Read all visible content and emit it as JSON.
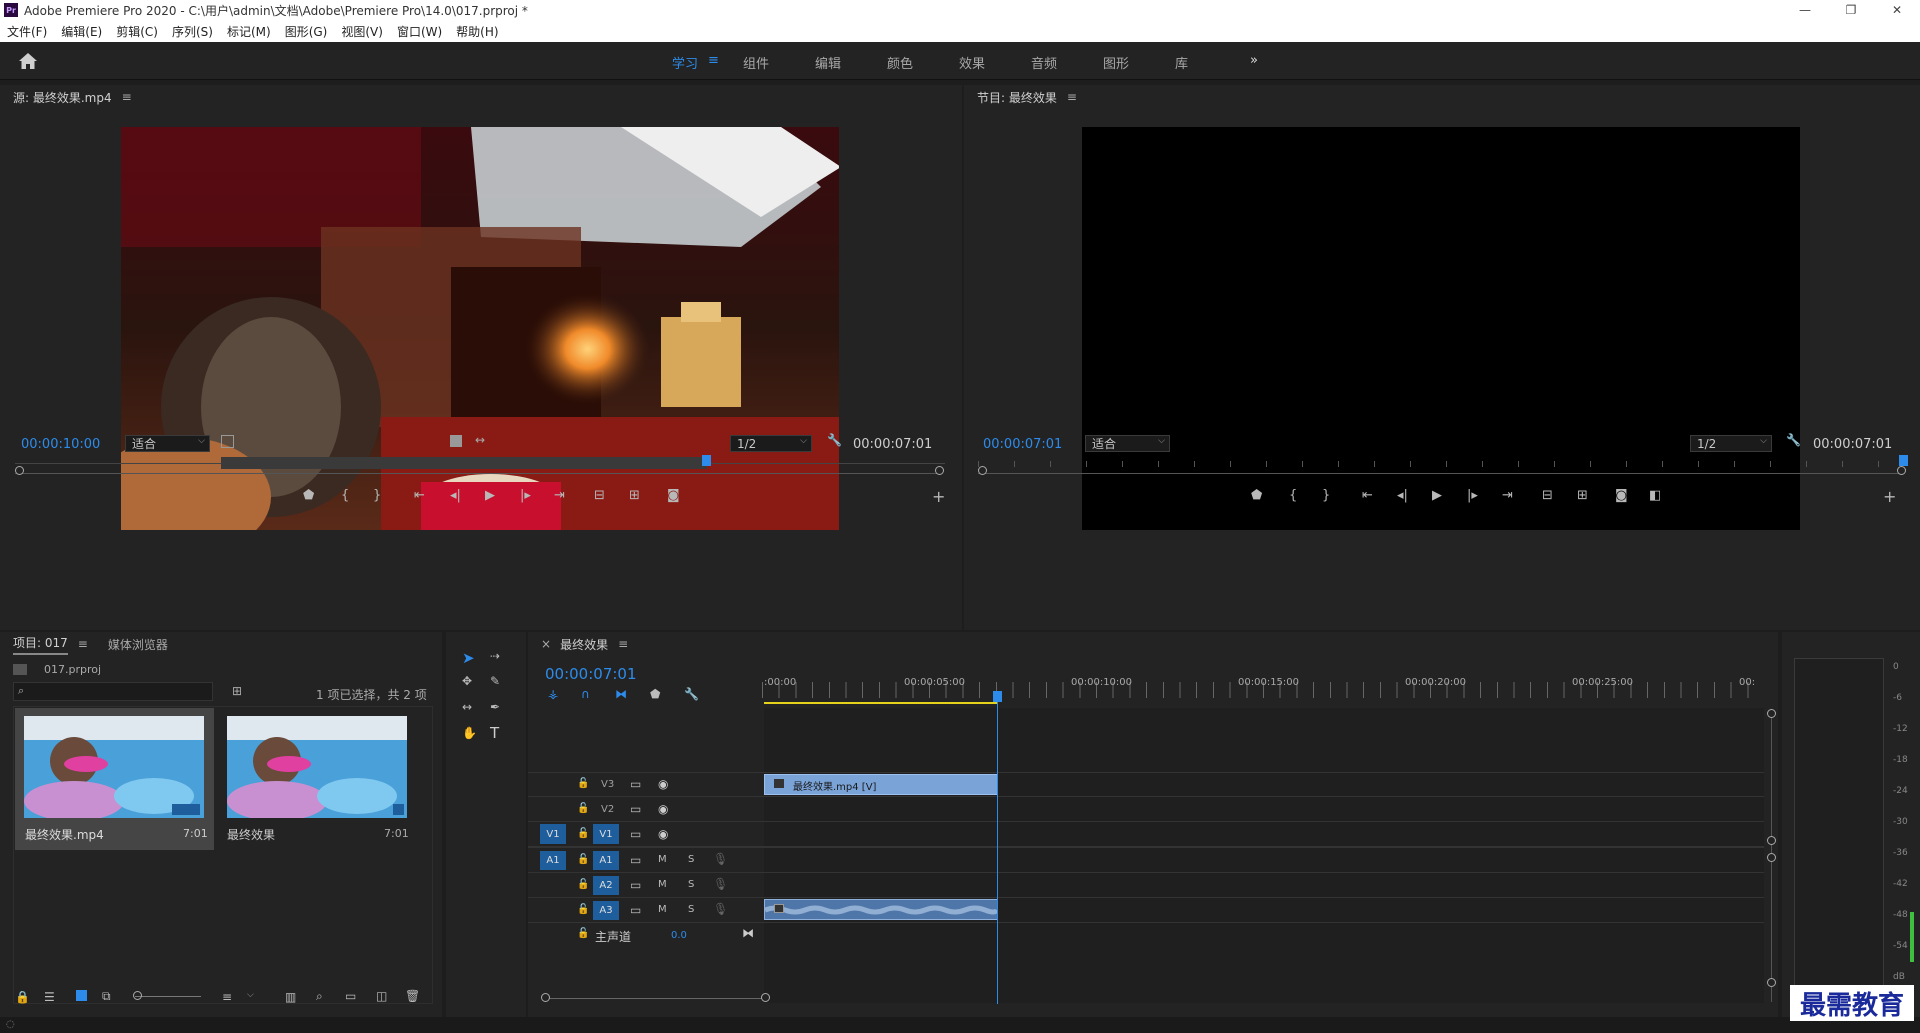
{
  "titlebar": {
    "icon": "Pr",
    "title": "Adobe Premiere Pro 2020 - C:\\用户\\admin\\文档\\Adobe\\Premiere Pro\\14.0\\017.prproj *",
    "minimize": "—",
    "restore": "❐",
    "close": "✕"
  },
  "menu": [
    "文件(F)",
    "编辑(E)",
    "剪辑(C)",
    "序列(S)",
    "标记(M)",
    "图形(G)",
    "视图(V)",
    "窗口(W)",
    "帮助(H)"
  ],
  "workspaces": [
    "学习",
    "组件",
    "编辑",
    "颜色",
    "效果",
    "音频",
    "图形",
    "库"
  ],
  "workspace_more": "»",
  "source": {
    "title": "源: 最终效果.mp4",
    "timecode_left": "00:00:10:00",
    "fit": "适合",
    "resolution": "1/2",
    "timecode_right": "00:00:07:01"
  },
  "program": {
    "title": "节目: 最终效果",
    "timecode_left": "00:00:07:01",
    "fit": "适合",
    "resolution": "1/2",
    "timecode_right": "00:00:07:01"
  },
  "project": {
    "tab_project": "项目: 017",
    "tab_media": "媒体浏览器",
    "file": "017.prproj",
    "selection": "1 项已选择，共 2 项",
    "items": [
      {
        "name": "最终效果.mp4",
        "duration": "7:01"
      },
      {
        "name": "最终效果",
        "duration": "7:01"
      }
    ]
  },
  "timeline": {
    "title": "最终效果",
    "timecode": "00:00:07:01",
    "ruler": [
      ":00:00",
      "00:00:05:00",
      "00:00:10:00",
      "00:00:15:00",
      "00:00:20:00",
      "00:00:25:00",
      "00:"
    ],
    "video_tracks": [
      "V3",
      "V2",
      "V1"
    ],
    "audio_tracks": [
      "A1",
      "A2",
      "A3"
    ],
    "source_v": "V1",
    "source_a": "A1",
    "master": "主声道",
    "master_value": "0.0",
    "mute": "M",
    "solo": "S",
    "clip_video": "最终效果.mp4 [V]"
  },
  "meter": {
    "labels": [
      "0",
      "-6",
      "-12",
      "-18",
      "-24",
      "-30",
      "-36",
      "-42",
      "-48",
      "-54",
      "dB"
    ]
  },
  "watermark": "最需教育"
}
